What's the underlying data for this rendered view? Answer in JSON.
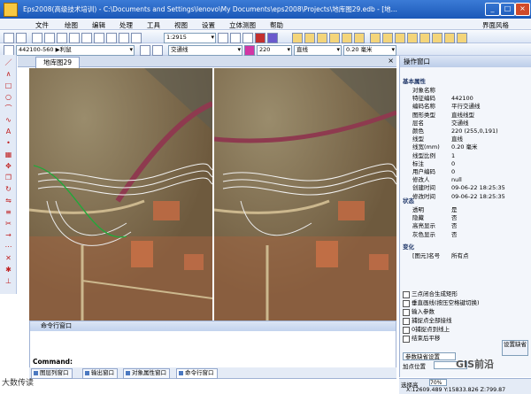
{
  "window": {
    "title": "Eps2008(高级技术培训) - C:\\Documents and Settings\\lenovo\\My Documents\\eps2008\\Projects\\地库图29.edb - [地...",
    "minimize": "_",
    "maximize": "□",
    "close": "×"
  },
  "menu": [
    "文件",
    "绘图",
    "编辑",
    "处理",
    "工具",
    "视图",
    "设置",
    "立体测图",
    "帮助"
  ],
  "menu_right": "界面风格",
  "toolbar": {
    "scale_value": "1:2915",
    "layer_value": "交通线",
    "code_value": "442100-560 ▶利鼠",
    "color_value": "220",
    "linetype_value": "直线",
    "width_value": "0.20 毫米"
  },
  "document": {
    "tab": "地库图29"
  },
  "command_window": {
    "title": "命令行窗口",
    "label": "Command:",
    "tabs": [
      "图层列窗口",
      "输出窗口",
      "对象属性窗口",
      "命令行窗口"
    ]
  },
  "panel": {
    "title": "操作窗口",
    "sections": {
      "basic": "基本属性",
      "status": "状态",
      "other": "变化"
    },
    "rows": [
      {
        "k": "对象名称",
        "v": ""
      },
      {
        "k": "特征编码",
        "v": "442100"
      },
      {
        "k": "编码名称",
        "v": "平行交通线"
      },
      {
        "k": "图形类型",
        "v": "直线线型"
      },
      {
        "k": "层名",
        "v": "交通线"
      },
      {
        "k": "颜色",
        "v": "220 (255,0,191)"
      },
      {
        "k": "线型",
        "v": "直线"
      },
      {
        "k": "线宽(mm)",
        "v": "0.20 毫米"
      },
      {
        "k": "线型比例",
        "v": "1"
      },
      {
        "k": "标注",
        "v": "0"
      },
      {
        "k": "用户编码",
        "v": "0"
      },
      {
        "k": "修改人",
        "v": "null"
      },
      {
        "k": "创建时间",
        "v": "09-06-22 18:25:35"
      },
      {
        "k": "修改时间",
        "v": "09-06-22 18:25:35"
      }
    ],
    "status_rows": [
      {
        "k": "透明",
        "v": "是"
      },
      {
        "k": "隐藏",
        "v": "否"
      },
      {
        "k": "高亮显示",
        "v": "否"
      },
      {
        "k": "灰色显示",
        "v": "否"
      }
    ],
    "other_rows": [
      {
        "k": "[图元]名号",
        "v": "所有点"
      }
    ],
    "checkboxes": [
      "三点闭合生成矩形",
      "垂直画线(按压空格键切换)",
      "输入参数",
      "捕捉点全部接线",
      "0捕捉点到线上",
      "结束后平移"
    ],
    "default_button": "参数缺省设置",
    "position_label": "加点位置",
    "restore_button": "设置缺省",
    "select_label": "选择高",
    "select_value": "70%"
  },
  "status": {
    "coords": "X:12609.489 Y:15833.826 Z:799.87"
  },
  "overlay": {
    "watermark": "GIS前沿",
    "logo_text": "大数传读"
  }
}
